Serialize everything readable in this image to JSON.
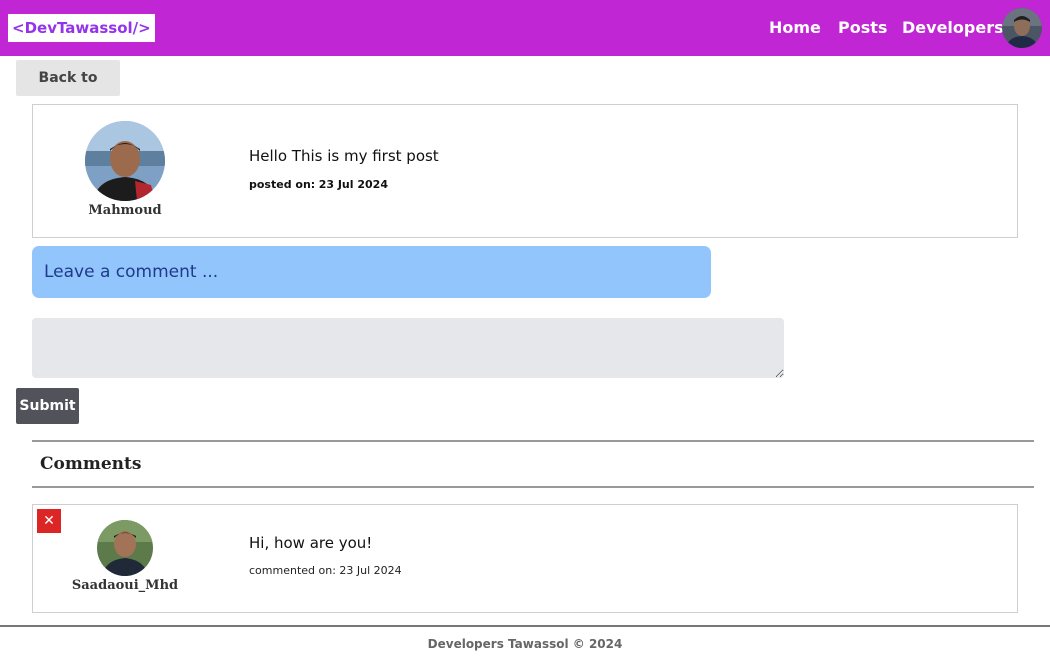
{
  "navbar": {
    "logo_text": "<DevTawassol/>",
    "links": [
      "Home",
      "Posts",
      "Developers"
    ],
    "brand_color": "#c026d3"
  },
  "back_button": "Back to posts",
  "post": {
    "author": "Mahmoud",
    "text": "Hello This is my first post",
    "date_label": "posted on:",
    "date": "23 Jul 2024"
  },
  "comment_form": {
    "heading": "Leave a comment ...",
    "textarea_value": "",
    "submit_label": "Submit"
  },
  "comments_section": {
    "heading": "Comments",
    "items": [
      {
        "delete_label": "✕",
        "author": "Saadaoui_Mhd",
        "text": "Hi, how are you!",
        "date_label": "commented on:",
        "date": "23 Jul 2024"
      }
    ]
  },
  "footer": {
    "text": "Developers Tawassol © 2024"
  }
}
